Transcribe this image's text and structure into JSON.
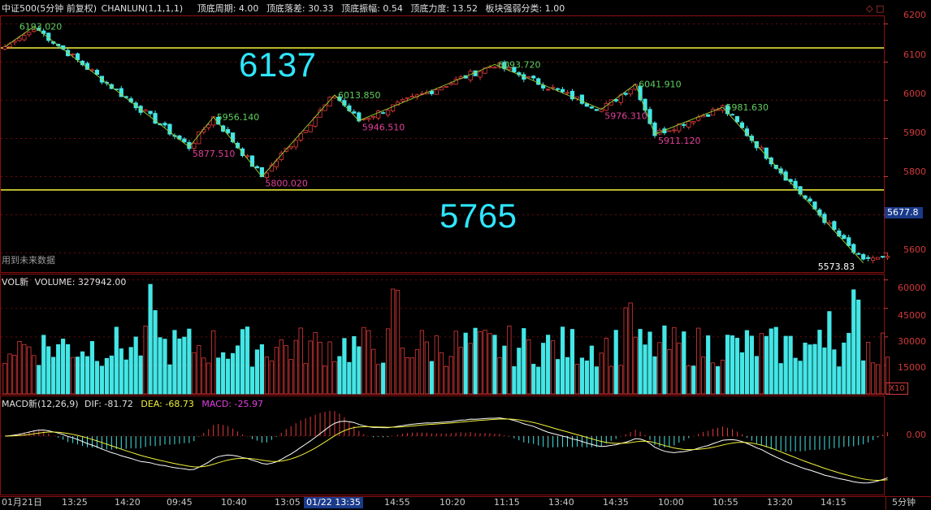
{
  "header": {
    "index_name": "中证500(5分钟 前复权)",
    "indicator": "CHANLUN(1,1,1,1)",
    "top_bottom_period": "顶底周期: 4.00",
    "top_bottom_drop": "顶底落差: 30.33",
    "top_bottom_amp": "顶底振幅: 0.54",
    "top_bottom_strength": "顶底力度: 13.52",
    "sector_class": "板块强弱分类: 1.00",
    "corner_icon": "◇ □"
  },
  "colors": {
    "up": "#e23a3a",
    "down": "#44e6e6",
    "level": "#f2f23a",
    "fib": "#2ee6ff",
    "ma_white": "#ffffff",
    "ma_yellow": "#f2f23a",
    "macd_purple": "#e040e0"
  },
  "annotations": {
    "level_high": "6137",
    "level_low": "5765",
    "future_data_note": "用到未来数据",
    "last_price": "5677.8",
    "low_marker": "5573.83"
  },
  "volume_header": {
    "label": "VOL新",
    "value": "VOLUME: 327942.00",
    "scale_note": "X10"
  },
  "macd_header": {
    "label": "MACD新(12,26,9)",
    "dif": "DIF: -81.72",
    "dea": "DEA: -68.73",
    "macd": "MACD: -25.97"
  },
  "axis": {
    "price_ticks": [
      "6200",
      "6100",
      "6000",
      "5900",
      "5800",
      "5600"
    ],
    "volume_ticks": [
      "60000",
      "45000",
      "30000",
      "15000"
    ],
    "macd_ticks": [
      "0.00"
    ]
  },
  "time_axis": [
    "01月21日",
    "13:25",
    "14:20",
    "09:45",
    "10:40",
    "13:05",
    "01/22 13:35",
    "14:55",
    "10:20",
    "11:15",
    "13:40",
    "14:35",
    "10:00",
    "10:55",
    "13:20",
    "14:15"
  ],
  "period_label": "5分钟",
  "chart_data": {
    "type": "candlestick",
    "price_ylim": [
      5550,
      6220
    ],
    "volume_ylim": [
      0,
      62000
    ],
    "pivots": [
      {
        "label": "6193.020",
        "price": 6193.0,
        "kind": "top"
      },
      {
        "label": "5877.510",
        "price": 5877.5,
        "kind": "bottom"
      },
      {
        "label": "5956.140",
        "price": 5956.1,
        "kind": "top"
      },
      {
        "label": "5800.020",
        "price": 5800.0,
        "kind": "bottom"
      },
      {
        "label": "6013.850",
        "price": 6013.9,
        "kind": "top"
      },
      {
        "label": "5946.510",
        "price": 5946.5,
        "kind": "bottom"
      },
      {
        "label": "6093.720",
        "price": 6093.7,
        "kind": "top"
      },
      {
        "label": "5976.310",
        "price": 5976.3,
        "kind": "bottom"
      },
      {
        "label": "6041.910",
        "price": 6041.9,
        "kind": "top"
      },
      {
        "label": "5911.120",
        "price": 5911.1,
        "kind": "bottom"
      },
      {
        "label": "5981.630",
        "price": 5981.6,
        "kind": "top"
      },
      {
        "label": "5573.83",
        "price": 5573.8,
        "kind": "bottom"
      }
    ]
  }
}
